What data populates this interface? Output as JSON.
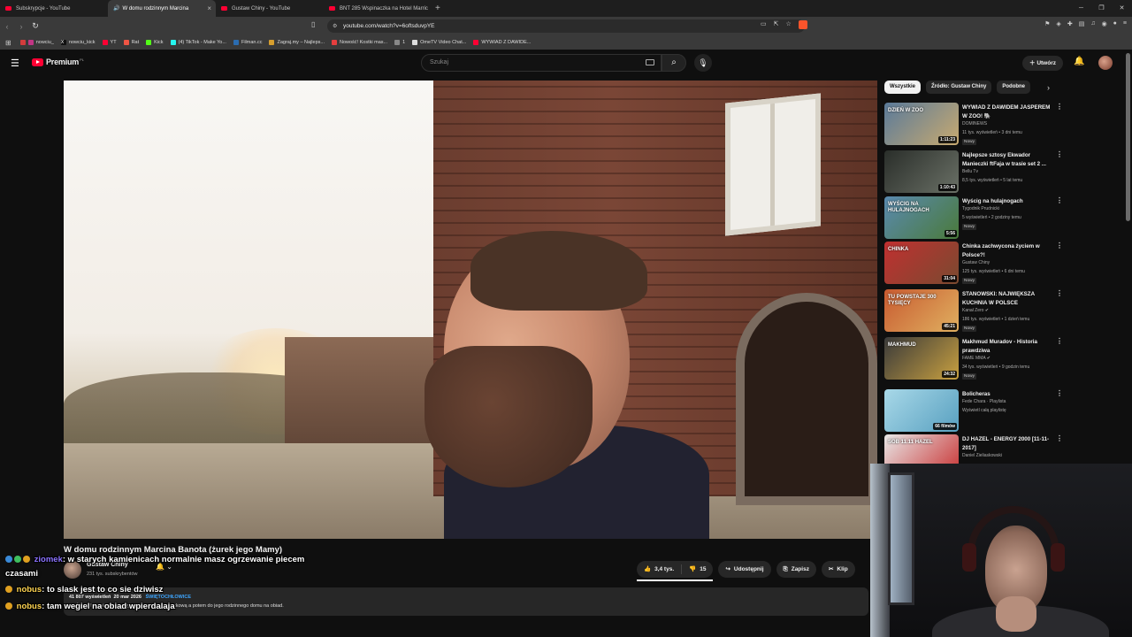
{
  "browser": {
    "tabs": [
      {
        "title": "Subskrypcje - YouTube",
        "active": false
      },
      {
        "title": "W domu rodzinnym Marcina",
        "active": true
      },
      {
        "title": "Gustaw Chiny - YouTube",
        "active": false
      },
      {
        "title": "BNT 285 Wspinaczka na Hotel Marric",
        "active": false
      }
    ],
    "new_tab": "+",
    "url": "youtube.com/watch?v=6oftsduvpYE",
    "bookmarks": [
      "nowciu_",
      "nowciu_kick",
      "YT",
      "Rat",
      "Kick",
      "(4) TikTok - Make Yo...",
      "Filman.cc",
      "Zagraj.my – Najleps...",
      "Nowość! Kostki mas...",
      "1",
      "OmeTV Video Chat...",
      "WYWIAD Z DAWIDE..."
    ]
  },
  "header": {
    "logo_text": "Premium",
    "logo_country": "PL",
    "search_placeholder": "Szukaj",
    "create_label": "Utwórz"
  },
  "video": {
    "title": "W domu rodzinnym Marcina Banota (żurek jego Mamy)",
    "channel": "Gustaw Chiny",
    "subscribers": "231 tys. subskrybentów",
    "likes": "3,4 tys.",
    "dislikes": "15",
    "share_label": "Udostępnij",
    "save_label": "Zapisz",
    "clip_label": "Klip",
    "views": "41 807 wyświetleń",
    "date": "20 mar 2026",
    "hashtag": "ŚWIĘTOCHŁOWICE",
    "description": "na Śląsku! Najpierw idziemy na ściankę wspinaczkową a potem do jego rodzinnego domu na obiad."
  },
  "chat": [
    {
      "user": "ziomek",
      "message": ": w starych kamienicach normalnie masz ogrzewanie piecem"
    },
    {
      "user": "",
      "message": "czasami"
    },
    {
      "user": "nobus",
      "message": ": to slask jest to co sie dziwisz"
    },
    {
      "user": "nobus",
      "message": ": tam wegiel na obiad wpierdalaja"
    }
  ],
  "sidebar": {
    "chips": [
      "Wszystkie",
      "Źródło: Gustaw Chiny",
      "Podobne"
    ],
    "items": [
      {
        "title": "WYWIAD Z DAWIDEM JASPEREM W ZOO! 🐘",
        "channel": "DOMINEWS",
        "meta": "11 tys. wyświetleń • 3 dni temu",
        "badge": "Nowy",
        "duration": "1:11:23",
        "colors": [
          "#5a7a9a",
          "#c8aa70"
        ],
        "thumb_text": "DZIEŃ W ZOO"
      },
      {
        "title": "Najlepsze sztosy Ekwador Manieczki ftFaja w trasie set 2 ...",
        "channel": "Bellu Tv",
        "meta": "8,5 tys. wyświetleń • 5 lat temu",
        "badge": "",
        "duration": "1:10:43",
        "colors": [
          "#2a2e2a",
          "#6a7066"
        ],
        "thumb_text": ""
      },
      {
        "title": "Wyścig na hulajnogach",
        "channel": "Tygodnik Prudnicki",
        "meta": "5 wyświetleń • 2 godziny temu",
        "badge": "Nowy",
        "duration": "5:56",
        "colors": [
          "#5a8ab0",
          "#4a7a3a"
        ],
        "thumb_text": "WYŚCIG NA HULAJNOGACH"
      },
      {
        "title": "Chinka zachwycona życiem w Polsce?!",
        "channel": "Gustaw Chiny",
        "meta": "125 tys. wyświetleń • 6 dni temu",
        "badge": "Nowy",
        "duration": "31:04",
        "colors": [
          "#c03030",
          "#7a4a30"
        ],
        "thumb_text": "CHINKA"
      },
      {
        "title": "STANOWSKI: NAJWIĘKSZA KUCHNIA W POLSCE",
        "channel": "Kanał Zero ✔",
        "meta": "186 tys. wyświetleń • 1 dzień temu",
        "badge": "Nowy",
        "duration": "45:21",
        "colors": [
          "#c85a30",
          "#e0b060"
        ],
        "thumb_text": "TU POWSTAJE 300 TYSIĘCY"
      },
      {
        "title": "Makhmud Muradov - Historia prawdziwa",
        "channel": "FAME MMA ✔",
        "meta": "34 tys. wyświetleń • 9 godzin temu",
        "badge": "Nowy",
        "duration": "24:32",
        "colors": [
          "#3a3a3a",
          "#c8a040"
        ],
        "thumb_text": "MAKHMUD"
      },
      {
        "title": "Bolicheras",
        "channel": "Fede Chara · Playlista",
        "meta": "Wyświetl całą playlistę",
        "badge": "",
        "duration": "66 filmów",
        "colors": [
          "#a8d8e8",
          "#58a0c0"
        ],
        "thumb_text": ""
      },
      {
        "title": "DJ HAZEL - ENERGY 2000 [11-11-2017]",
        "channel": "Daniel Zieliaskowski",
        "meta": "",
        "badge": "",
        "duration": "",
        "colors": [
          "#e8e8e8",
          "#c83030"
        ],
        "thumb_text": "SOB 11.11 HAZEL"
      }
    ]
  }
}
